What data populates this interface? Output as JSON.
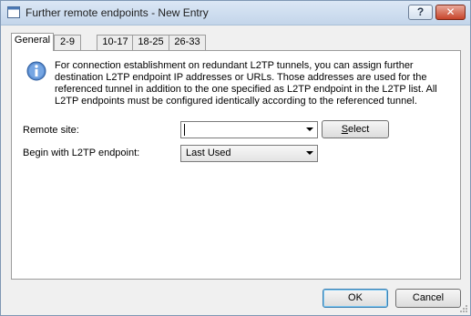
{
  "window": {
    "title": "Further remote endpoints - New Entry",
    "help_label": "?",
    "close_label": "✕"
  },
  "tabs": [
    {
      "label": "General"
    },
    {
      "label": "2-9"
    },
    {
      "label": "10-17"
    },
    {
      "label": "18-25"
    },
    {
      "label": "26-33"
    }
  ],
  "info": {
    "icon": "info-icon",
    "text": "For connection establishment on redundant L2TP tunnels, you can assign further destination L2TP endpoint IP addresses or URLs. Those addresses are used for the referenced tunnel in addition to the one specified as L2TP endpoint in the L2TP list. All L2TP endpoints must be configured identically according to the referenced tunnel."
  },
  "form": {
    "remote_site_label": "Remote site:",
    "remote_site_value": "",
    "select_button_underline": "S",
    "select_button_rest": "elect",
    "begin_label": "Begin with L2TP endpoint:",
    "begin_value": "Last Used"
  },
  "footer": {
    "ok_label": "OK",
    "cancel_label": "Cancel"
  }
}
